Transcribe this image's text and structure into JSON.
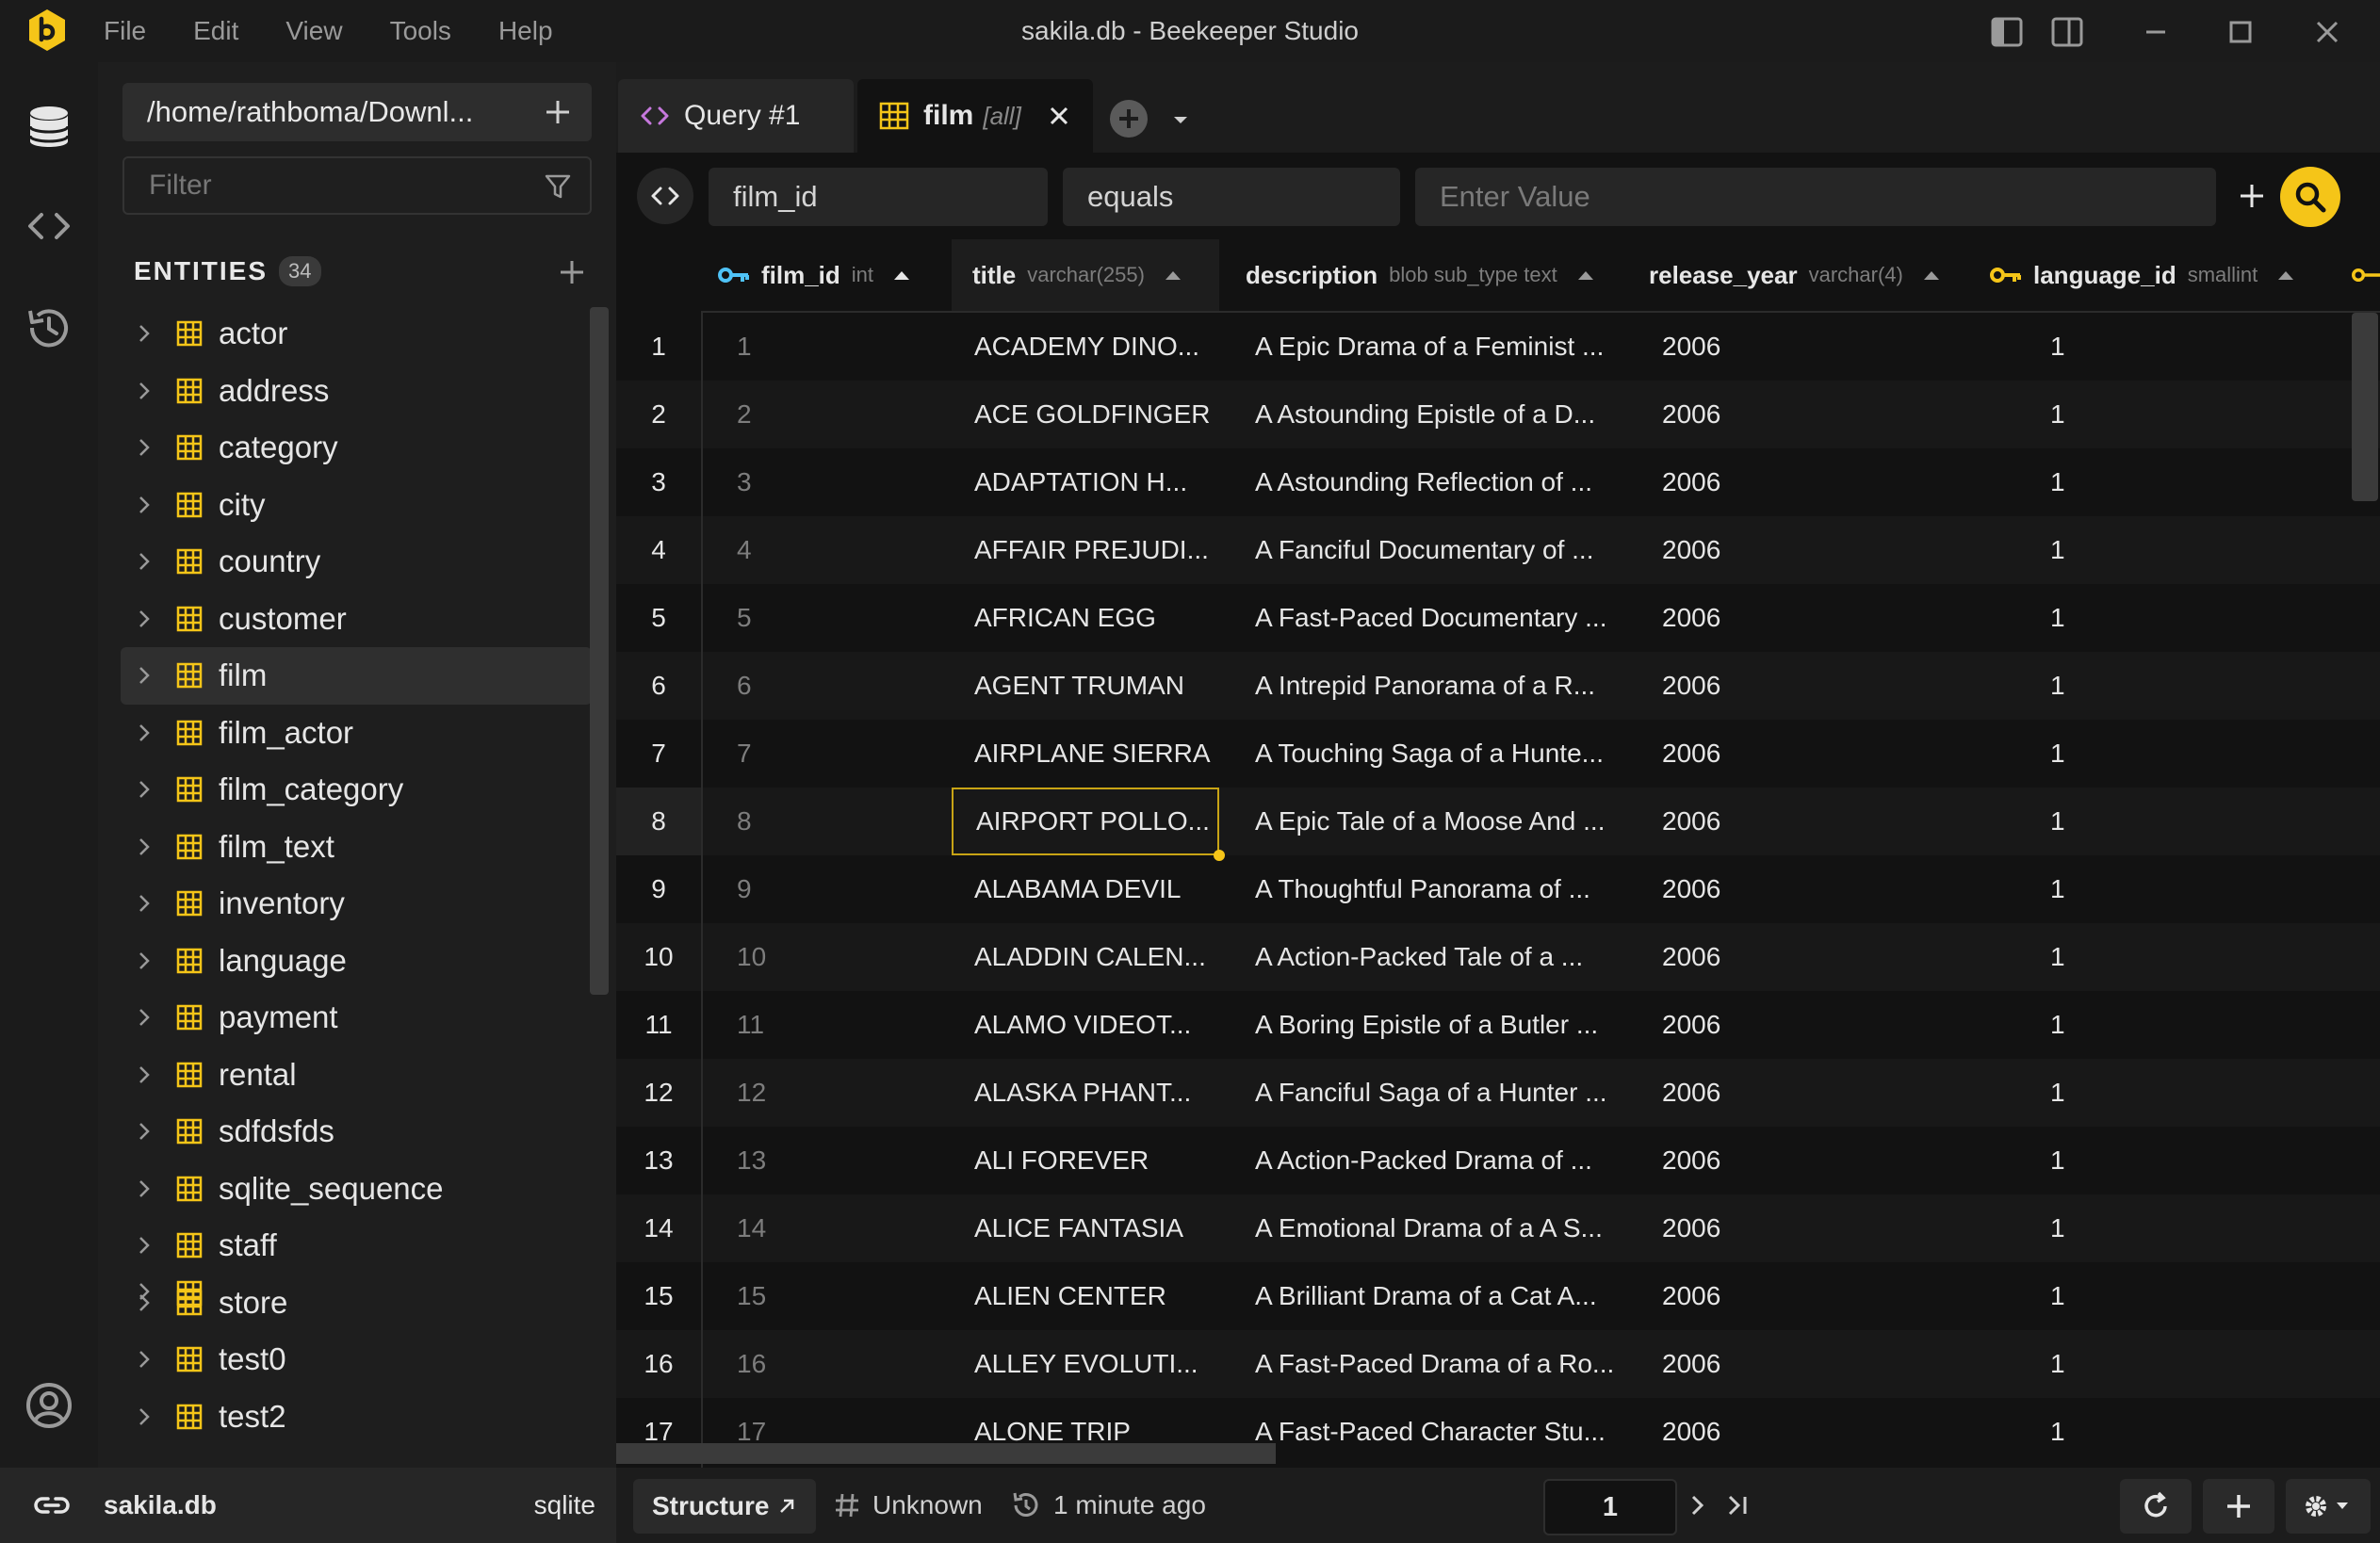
{
  "window": {
    "title": "sakila.db - Beekeeper Studio",
    "menu": [
      "File",
      "Edit",
      "View",
      "Tools",
      "Help"
    ]
  },
  "colors": {
    "accent": "#f5c518",
    "background": "#121212",
    "sidebar": "#1e1e1e"
  },
  "sidebar": {
    "connection_path": "/home/rathboma/Downl...",
    "filter_placeholder": "Filter",
    "entities_label": "ENTITIES",
    "entities_count": "34",
    "entities": [
      "actor",
      "address",
      "category",
      "city",
      "country",
      "customer",
      "film",
      "film_actor",
      "film_category",
      "film_text",
      "inventory",
      "language",
      "payment",
      "rental",
      "sdfdsfds",
      "sqlite_sequence",
      "staff",
      "store",
      "test0",
      "test2"
    ],
    "selected_entity": "film"
  },
  "tabs": [
    {
      "label": "Query #1",
      "icon": "code-icon"
    },
    {
      "label": "film",
      "sub": "[all]",
      "icon": "table-icon",
      "active": true
    }
  ],
  "filter": {
    "column": "film_id",
    "operator": "equals",
    "value_placeholder": "Enter Value"
  },
  "grid": {
    "columns": [
      {
        "name": "film_id",
        "type": "int",
        "key": true
      },
      {
        "name": "title",
        "type": "varchar(255)"
      },
      {
        "name": "description",
        "type": "blob sub_type text"
      },
      {
        "name": "release_year",
        "type": "varchar(4)"
      },
      {
        "name": "language_id",
        "type": "smallint",
        "key": true
      }
    ],
    "rows": [
      [
        "1",
        "1",
        "ACADEMY DINO...",
        "A Epic Drama of a Feminist ...",
        "2006",
        "1"
      ],
      [
        "2",
        "2",
        "ACE GOLDFINGER",
        "A Astounding Epistle of a D...",
        "2006",
        "1"
      ],
      [
        "3",
        "3",
        "ADAPTATION H...",
        "A Astounding Reflection of ...",
        "2006",
        "1"
      ],
      [
        "4",
        "4",
        "AFFAIR PREJUDI...",
        "A Fanciful Documentary of ...",
        "2006",
        "1"
      ],
      [
        "5",
        "5",
        "AFRICAN EGG",
        "A Fast-Paced Documentary ...",
        "2006",
        "1"
      ],
      [
        "6",
        "6",
        "AGENT TRUMAN",
        "A Intrepid Panorama of a R...",
        "2006",
        "1"
      ],
      [
        "7",
        "7",
        "AIRPLANE SIERRA",
        "A Touching Saga of a Hunte...",
        "2006",
        "1"
      ],
      [
        "8",
        "8",
        "AIRPORT POLLO...",
        "A Epic Tale of a Moose And ...",
        "2006",
        "1"
      ],
      [
        "9",
        "9",
        "ALABAMA DEVIL",
        "A Thoughtful Panorama of ...",
        "2006",
        "1"
      ],
      [
        "10",
        "10",
        "ALADDIN CALEN...",
        "A Action-Packed Tale of a ...",
        "2006",
        "1"
      ],
      [
        "11",
        "11",
        "ALAMO VIDEOT...",
        "A Boring Epistle of a Butler ...",
        "2006",
        "1"
      ],
      [
        "12",
        "12",
        "ALASKA PHANT...",
        "A Fanciful Saga of a Hunter ...",
        "2006",
        "1"
      ],
      [
        "13",
        "13",
        "ALI FOREVER",
        "A Action-Packed Drama of ...",
        "2006",
        "1"
      ],
      [
        "14",
        "14",
        "ALICE FANTASIA",
        "A Emotional Drama of a A S...",
        "2006",
        "1"
      ],
      [
        "15",
        "15",
        "ALIEN CENTER",
        "A Brilliant Drama of a Cat A...",
        "2006",
        "1"
      ],
      [
        "16",
        "16",
        "ALLEY EVOLUTI...",
        "A Fast-Paced Drama of a Ro...",
        "2006",
        "1"
      ],
      [
        "17",
        "17",
        "ALONE TRIP",
        "A Fast-Paced Character Stu...",
        "2006",
        "1"
      ]
    ]
  },
  "status": {
    "db_name": "sakila.db",
    "db_type": "sqlite",
    "structure_label": "Structure",
    "unknown_label": "Unknown",
    "time_label": "1 minute ago",
    "page": "1"
  }
}
